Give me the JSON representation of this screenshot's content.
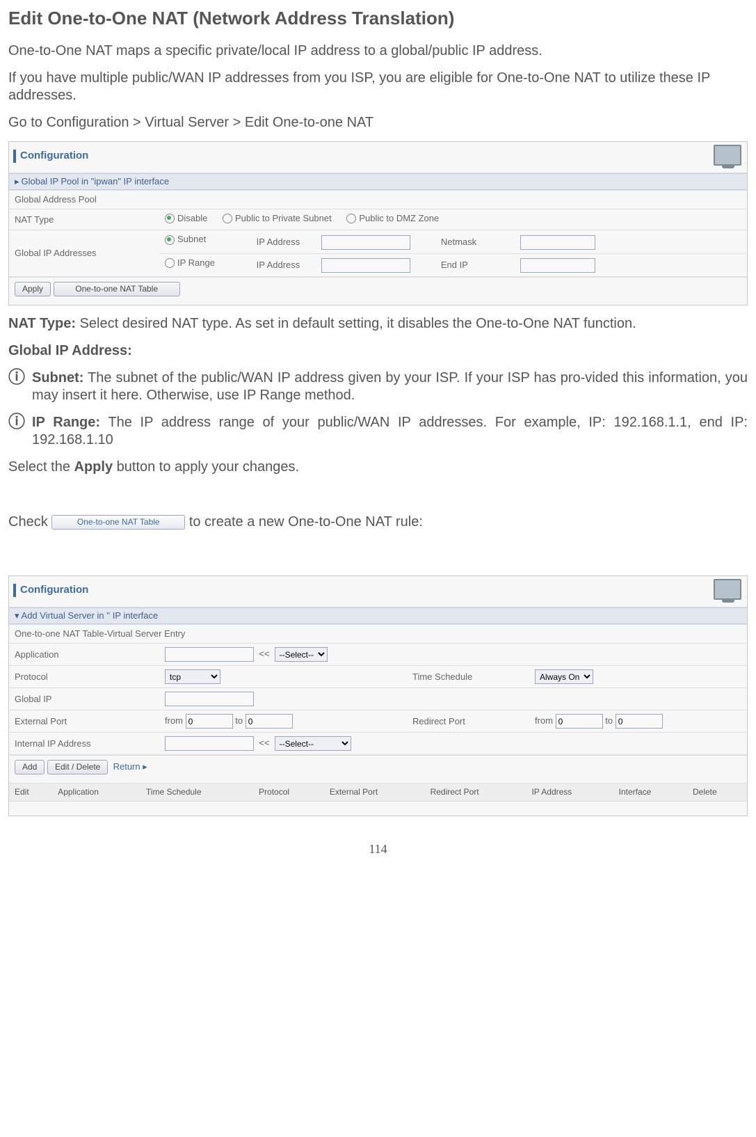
{
  "page": {
    "title": "Edit One-to-One NAT (Network Address Translation)",
    "intro1": "One-to-One NAT maps a specific private/local IP address to a global/public IP address.",
    "intro2": "If you have multiple public/WAN IP addresses from you ISP, you are eligible for One-to-One NAT to utilize these IP addresses.",
    "breadcrumb": "Go to Configuration > Virtual Server > Edit One-to-one NAT",
    "nat_type_label": "NAT Type:",
    "nat_type_text": " Select desired NAT type. As set in default setting, it disables the One-to-One NAT function.",
    "global_ip_label": "Global IP Address:",
    "subnet_label": "Subnet:",
    "subnet_text": " The subnet of the public/WAN IP address given by your ISP.  If your ISP has pro-vided this information, you may insert it here.  Otherwise, use IP Range method.",
    "iprange_label": "IP Range:",
    "iprange_text": "  The IP address range of your public/WAN IP addresses. For example, IP: 192.168.1.1, end IP: 192.168.1.10",
    "apply_pre": "Select the ",
    "apply_bold": "Apply",
    "apply_post": " button to apply your changes.",
    "check_pre": "Check ",
    "check_btn": "One-to-one NAT Table",
    "check_post": " to create a new One-to-One NAT rule:",
    "number": "114"
  },
  "panel1": {
    "title": "Configuration",
    "section": "Global IP Pool in \"ipwan\" IP interface",
    "row1": "Global Address Pool",
    "nat_type": "NAT Type",
    "disable": "Disable",
    "pub2priv": "Public to Private Subnet",
    "pub2dmz": "Public to DMZ Zone",
    "global_ip": "Global IP Addresses",
    "subnet": "Subnet",
    "ipaddr": "IP Address",
    "netmask": "Netmask",
    "iprange": "IP Range",
    "endip": "End IP",
    "apply": "Apply",
    "table_btn": "One-to-one NAT Table"
  },
  "panel2": {
    "title": "Configuration",
    "section": "Add Virtual Server in '' IP interface",
    "row1": "One-to-one NAT Table-Virtual Server Entry",
    "application": "Application",
    "select": "--Select--",
    "protocol": "Protocol",
    "tcp": "tcp",
    "timesched": "Time Schedule",
    "always": "Always On",
    "globalip": "Global IP",
    "extport": "External Port",
    "from": "from",
    "to": "to",
    "redirport": "Redirect Port",
    "intip": "Internal IP Address",
    "add": "Add",
    "editdel": "Edit / Delete",
    "return": "Return",
    "hdr_edit": "Edit",
    "hdr_app": "Application",
    "hdr_time": "Time Schedule",
    "hdr_proto": "Protocol",
    "hdr_ext": "External Port",
    "hdr_redir": "Redirect Port",
    "hdr_ip": "IP Address",
    "hdr_if": "Interface",
    "hdr_del": "Delete",
    "zero": "0"
  }
}
